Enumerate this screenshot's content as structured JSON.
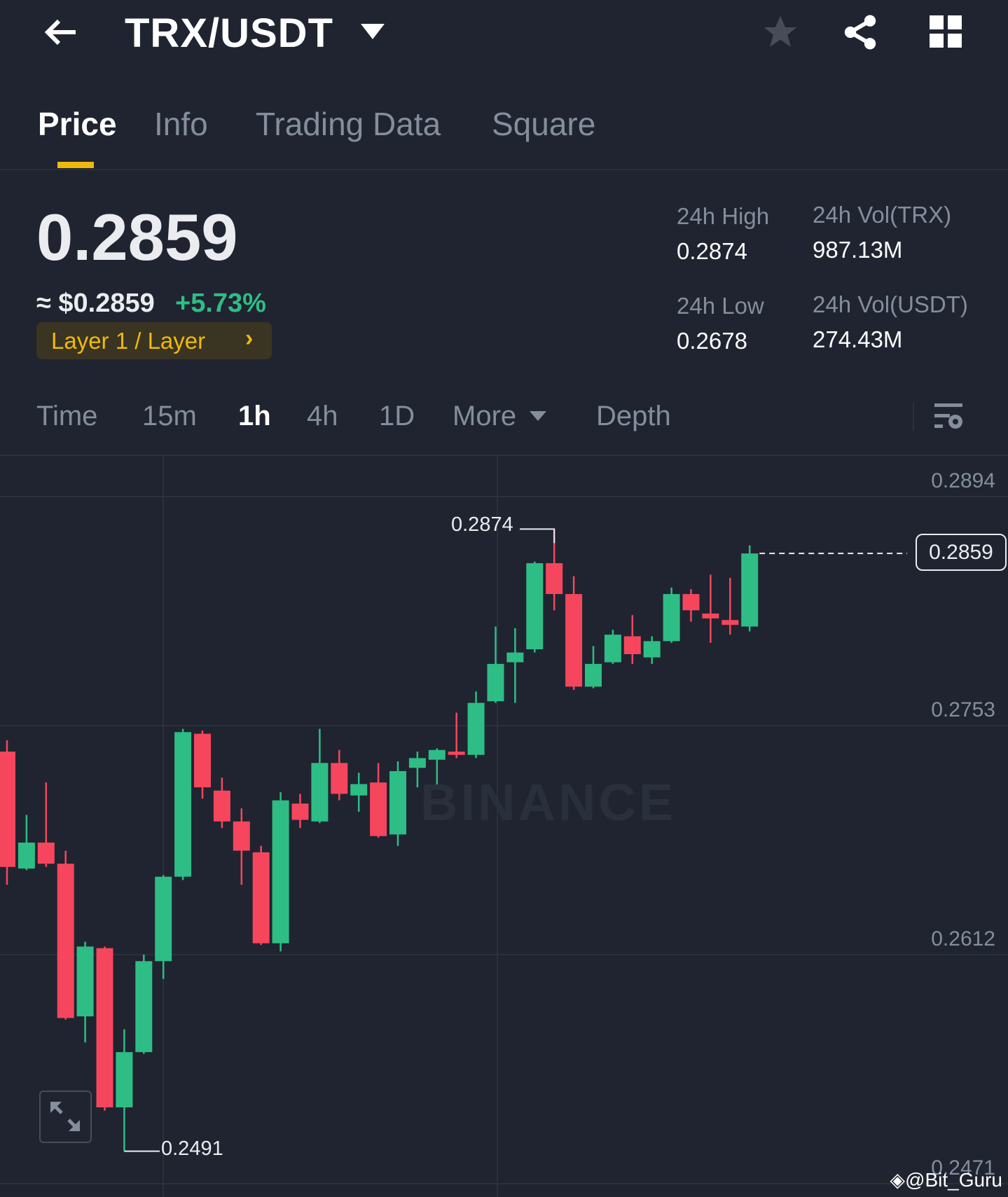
{
  "header": {
    "title": "TRX/USDT",
    "icons": [
      "back-arrow-icon",
      "dropdown-icon",
      "star-icon",
      "share-icon",
      "grid-icon"
    ]
  },
  "tabs": [
    {
      "label": "Price"
    },
    {
      "label": "Info"
    },
    {
      "label": "Trading Data"
    },
    {
      "label": "Square"
    }
  ],
  "price": {
    "last": "0.2859",
    "usd": "≈ $0.2859",
    "change": "+5.73%",
    "tag": "Layer 1 / Layer"
  },
  "stats": {
    "high_label": "24h High",
    "high": "0.2874",
    "low_label": "24h Low",
    "low": "0.2678",
    "vol_trx_label": "24h Vol(TRX)",
    "vol_trx": "987.13M",
    "vol_usdt_label": "24h Vol(USDT)",
    "vol_usdt": "274.43M"
  },
  "timeframes": [
    {
      "label": "Time"
    },
    {
      "label": "15m"
    },
    {
      "label": "1h"
    },
    {
      "label": "4h"
    },
    {
      "label": "1D"
    },
    {
      "label": "More"
    },
    {
      "label": "Depth"
    }
  ],
  "colors": {
    "up": "#2ebd85",
    "down": "#f6465d",
    "accent": "#f0b90b",
    "bg": "#1f2430"
  },
  "watermark": "BINANCE",
  "credit": "@Bit_Guru",
  "chart_data": {
    "type": "candlestick",
    "interval": "1h",
    "y_ticks": [
      "0.2894",
      "0.2753",
      "0.2612",
      "0.2471"
    ],
    "ylim": [
      0.2454,
      0.2915
    ],
    "high_marker": "0.2874",
    "low_marker": "0.2491",
    "current_price": "0.2859",
    "ohlc": [
      [
        0.2737,
        0.2744,
        0.2655,
        0.2666
      ],
      [
        0.2665,
        0.2698,
        0.2664,
        0.2681
      ],
      [
        0.2681,
        0.2718,
        0.2666,
        0.2668
      ],
      [
        0.2668,
        0.2676,
        0.2572,
        0.2573
      ],
      [
        0.2574,
        0.262,
        0.2558,
        0.2617
      ],
      [
        0.2616,
        0.2617,
        0.2516,
        0.2518
      ],
      [
        0.2518,
        0.2566,
        0.2491,
        0.2552
      ],
      [
        0.2552,
        0.2612,
        0.2551,
        0.2608
      ],
      [
        0.2608,
        0.2661,
        0.2597,
        0.266
      ],
      [
        0.266,
        0.2751,
        0.2658,
        0.2749
      ],
      [
        0.2748,
        0.275,
        0.2708,
        0.2715
      ],
      [
        0.2713,
        0.2721,
        0.269,
        0.2694
      ],
      [
        0.2694,
        0.2702,
        0.2655,
        0.2676
      ],
      [
        0.2675,
        0.2679,
        0.2618,
        0.2619
      ],
      [
        0.2619,
        0.2712,
        0.2614,
        0.2707
      ],
      [
        0.2705,
        0.2711,
        0.269,
        0.2695
      ],
      [
        0.2694,
        0.2751,
        0.2693,
        0.273
      ],
      [
        0.273,
        0.2738,
        0.2707,
        0.2711
      ],
      [
        0.271,
        0.2724,
        0.27,
        0.2717
      ],
      [
        0.2718,
        0.273,
        0.2684,
        0.2685
      ],
      [
        0.2686,
        0.2731,
        0.2679,
        0.2725
      ],
      [
        0.2727,
        0.2737,
        0.2715,
        0.2733
      ],
      [
        0.2732,
        0.2739,
        0.2715,
        0.2738
      ],
      [
        0.2737,
        0.2761,
        0.2733,
        0.2735
      ],
      [
        0.2735,
        0.2774,
        0.2733,
        0.2767
      ],
      [
        0.2768,
        0.2814,
        0.2767,
        0.2791
      ],
      [
        0.2792,
        0.2813,
        0.2767,
        0.2798
      ],
      [
        0.28,
        0.2854,
        0.2798,
        0.2853
      ],
      [
        0.2853,
        0.2874,
        0.2824,
        0.2834
      ],
      [
        0.2834,
        0.2845,
        0.2775,
        0.2777
      ],
      [
        0.2777,
        0.2802,
        0.2776,
        0.2791
      ],
      [
        0.2792,
        0.2812,
        0.2791,
        0.2809
      ],
      [
        0.2808,
        0.2821,
        0.2791,
        0.2797
      ],
      [
        0.2795,
        0.2808,
        0.2791,
        0.2805
      ],
      [
        0.2805,
        0.2838,
        0.2804,
        0.2834
      ],
      [
        0.2834,
        0.2837,
        0.2817,
        0.2824
      ],
      [
        0.2822,
        0.2846,
        0.2804,
        0.2819
      ],
      [
        0.2818,
        0.2844,
        0.2809,
        0.2815
      ],
      [
        0.2814,
        0.2864,
        0.2811,
        0.2859
      ]
    ]
  }
}
